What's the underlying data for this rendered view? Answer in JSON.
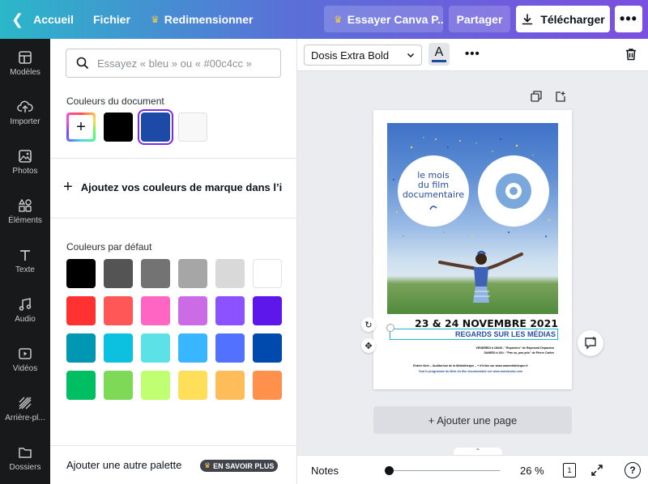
{
  "topbar": {
    "back_label": "Accueil",
    "file_label": "Fichier",
    "resize_label": "Redimensionner",
    "try_label": "Essayer Canva P...",
    "share_label": "Partager",
    "download_label": "Télécharger"
  },
  "rail": {
    "items": [
      {
        "label": "Modèles",
        "icon": "templates-icon"
      },
      {
        "label": "Importer",
        "icon": "upload-icon"
      },
      {
        "label": "Photos",
        "icon": "photos-icon"
      },
      {
        "label": "Éléments",
        "icon": "elements-icon"
      },
      {
        "label": "Texte",
        "icon": "text-icon"
      },
      {
        "label": "Audio",
        "icon": "audio-icon"
      },
      {
        "label": "Vidéos",
        "icon": "video-icon"
      },
      {
        "label": "Arrière-pl...",
        "icon": "background-icon"
      },
      {
        "label": "Dossiers",
        "icon": "folder-icon"
      }
    ]
  },
  "panel": {
    "search_placeholder": "Essayez « bleu » ou « #00c4cc »",
    "doc_colors_title": "Couleurs du document",
    "doc_colors": [
      "#000000",
      "#1d49a7",
      "#f8f8f8"
    ],
    "brand_colors_label": "Ajoutez vos couleurs de marque dans l’id...",
    "default_colors_title": "Couleurs par défaut",
    "default_colors": [
      [
        "#000000",
        "#545454",
        "#737373",
        "#a6a6a6",
        "#d9d9d9",
        "#ffffff"
      ],
      [
        "#ff3131",
        "#ff5757",
        "#ff66c4",
        "#cb6ce6",
        "#8c52ff",
        "#5e17eb"
      ],
      [
        "#0097b2",
        "#0cc0df",
        "#5ce1e6",
        "#38b6ff",
        "#5271ff",
        "#004aad"
      ],
      [
        "#00bf63",
        "#7ed957",
        "#c1ff72",
        "#ffde59",
        "#ffbd59",
        "#ff914d"
      ]
    ],
    "another_palette_label": "Ajouter une autre palette",
    "learn_more_label": "EN SAVOIR PLUS"
  },
  "toolbar": {
    "font_name": "Dosis Extra Bold",
    "text_color": "#1d49a7"
  },
  "poster": {
    "circle_text_1": "le mois",
    "circle_text_2": "du film",
    "circle_text_3": "documentaire",
    "date": "23 & 24 NOVEMBRE 2021",
    "regards": "REGARDS SUR LES MÉDIAS",
    "line1": "VENDREDI à 18h30 : \"Reporters\" de Raymond Depardon",
    "line2": "SAMEDI à 16h : \"Pas vu, pas pris\" de Pierre Carles",
    "line3": "Entrée libre – Auditorium de la Médiathèque – + d’infos sur www.mamediatheque.fr",
    "line4": "Tout le programme du Mois du film documentaire sur www.moisdudoc.com"
  },
  "canvas": {
    "add_page_label": "+ Ajouter une page"
  },
  "status": {
    "notes_label": "Notes",
    "zoom_label": "26 %",
    "zoom_percent": 26,
    "pages_count": "1"
  }
}
